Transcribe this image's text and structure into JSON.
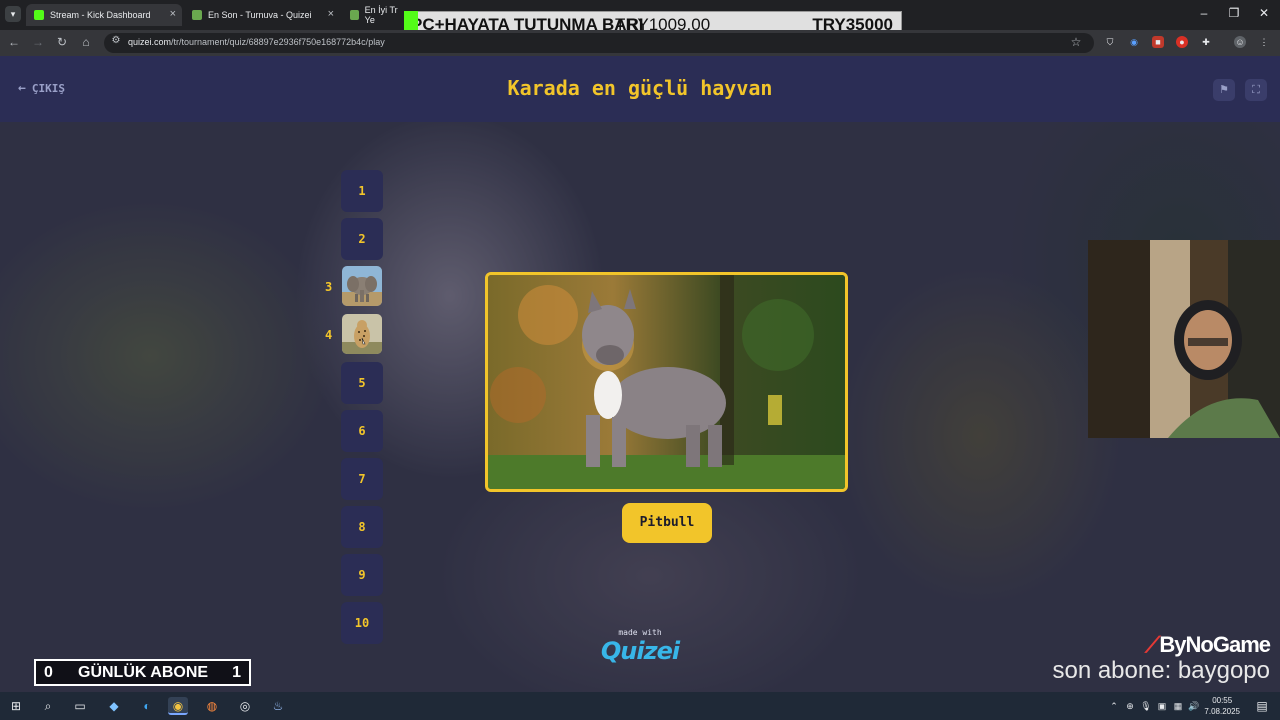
{
  "browser": {
    "tabs": [
      {
        "label": "Stream - Kick Dashboard",
        "color": "#53fc18"
      },
      {
        "label": "En Son - Turnuva - Quizei",
        "color": "#6aa84f"
      },
      {
        "label": "En İyi Tr Ye",
        "color": "#6aa84f"
      }
    ],
    "url_host": "quizei.com",
    "url_path": "/tr/tournament/quiz/68897e2936f750e168772b4c/play"
  },
  "overlay_banner": {
    "left_text": "PC+HAYATA TUTUNMA BARI",
    "mid_text": "TRY1009.00",
    "right_text": "TRY35000"
  },
  "quiz": {
    "exit_label": "ÇIKIŞ",
    "title": "Karada en güçlü hayvan",
    "rounds": [
      {
        "label": "1",
        "has_image": false
      },
      {
        "label": "2",
        "has_image": false
      },
      {
        "label": "3",
        "has_image": true,
        "icon": "elephant"
      },
      {
        "label": "4",
        "has_image": true,
        "icon": "leopard"
      },
      {
        "label": "5",
        "has_image": false
      },
      {
        "label": "6",
        "has_image": false
      },
      {
        "label": "7",
        "has_image": false
      },
      {
        "label": "8",
        "has_image": false
      },
      {
        "label": "9",
        "has_image": false
      },
      {
        "label": "10",
        "has_image": false
      }
    ],
    "answer": "Pitbull",
    "made_with": "made with",
    "brand": "Quizei",
    "accent": "#f2c52a",
    "header_bg": "#2b2d55"
  },
  "stream_overlay": {
    "sub_counter": {
      "left": "0",
      "label": "GÜNLÜK ABONE",
      "right": "1"
    },
    "sponsor": "ByNoGame",
    "last_sub": "son abone: baygopo"
  },
  "taskbar": {
    "time": "00:55",
    "date": "7.08.2025"
  }
}
